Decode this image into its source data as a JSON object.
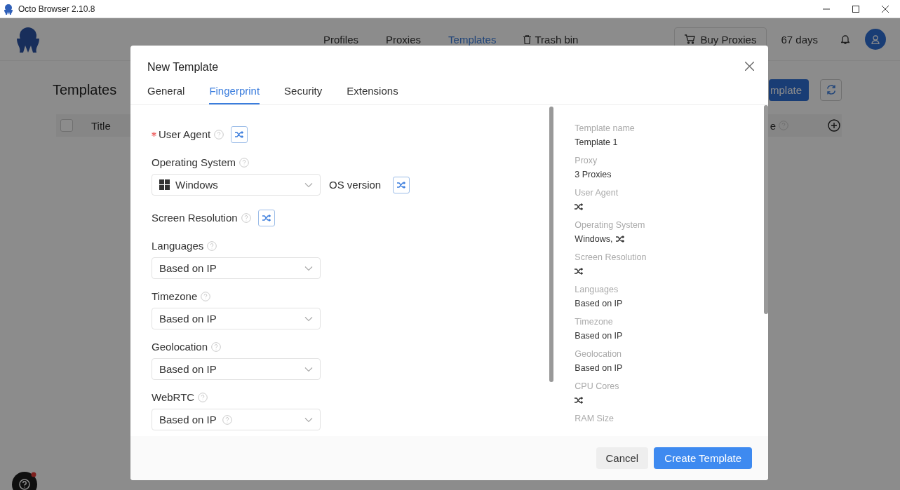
{
  "window": {
    "title": "Octo Browser 2.10.8"
  },
  "nav": [
    {
      "label": "Profiles",
      "selected": false,
      "kind": "plain"
    },
    {
      "label": "Proxies",
      "selected": false,
      "kind": "plain"
    },
    {
      "label": "Templates",
      "selected": true,
      "kind": "plain"
    },
    {
      "label": "Trash bin",
      "selected": false,
      "kind": "trash"
    }
  ],
  "header": {
    "buy_button": "Buy Proxies",
    "days": "67 days"
  },
  "page": {
    "title": "Templates",
    "new_button": "mplate",
    "all_checked": false,
    "columns": [
      "Title",
      "e"
    ]
  },
  "dialog": {
    "title": "New Template",
    "tabs": [
      {
        "label": "General",
        "selected": false
      },
      {
        "label": "Fingerprint",
        "selected": true
      },
      {
        "label": "Security",
        "selected": false
      },
      {
        "label": "Extensions",
        "selected": false
      }
    ],
    "fields": [
      {
        "kind": "random",
        "label": "User Agent",
        "required": true
      },
      {
        "kind": "os",
        "label": "Operating System",
        "required": false,
        "value": "Windows",
        "version_label": "OS version"
      },
      {
        "kind": "random",
        "label": "Screen Resolution",
        "required": false
      },
      {
        "kind": "select",
        "label": "Languages",
        "required": false,
        "value": "Based on IP"
      },
      {
        "kind": "select",
        "label": "Timezone",
        "required": false,
        "value": "Based on IP"
      },
      {
        "kind": "select",
        "label": "Geolocation",
        "required": false,
        "value": "Based on IP"
      },
      {
        "kind": "select",
        "label": "WebRTC",
        "required": false,
        "value": "Based on IP",
        "value_help": true
      }
    ],
    "summary": [
      {
        "label": "Template name",
        "value": "Template 1",
        "random": false
      },
      {
        "label": "Proxy",
        "value": "3 Proxies",
        "random": false
      },
      {
        "label": "User Agent",
        "random": true
      },
      {
        "label": "Operating System",
        "value": "Windows,",
        "random": true
      },
      {
        "label": "Screen Resolution",
        "random": true
      },
      {
        "label": "Languages",
        "value": "Based on IP",
        "random": false
      },
      {
        "label": "Timezone",
        "value": "Based on IP",
        "random": false
      },
      {
        "label": "Geolocation",
        "value": "Based on IP",
        "random": false
      },
      {
        "label": "CPU Cores",
        "random": true
      },
      {
        "label": "RAM Size",
        "random": false
      }
    ],
    "cancel": "Cancel",
    "submit": "Create Template"
  }
}
